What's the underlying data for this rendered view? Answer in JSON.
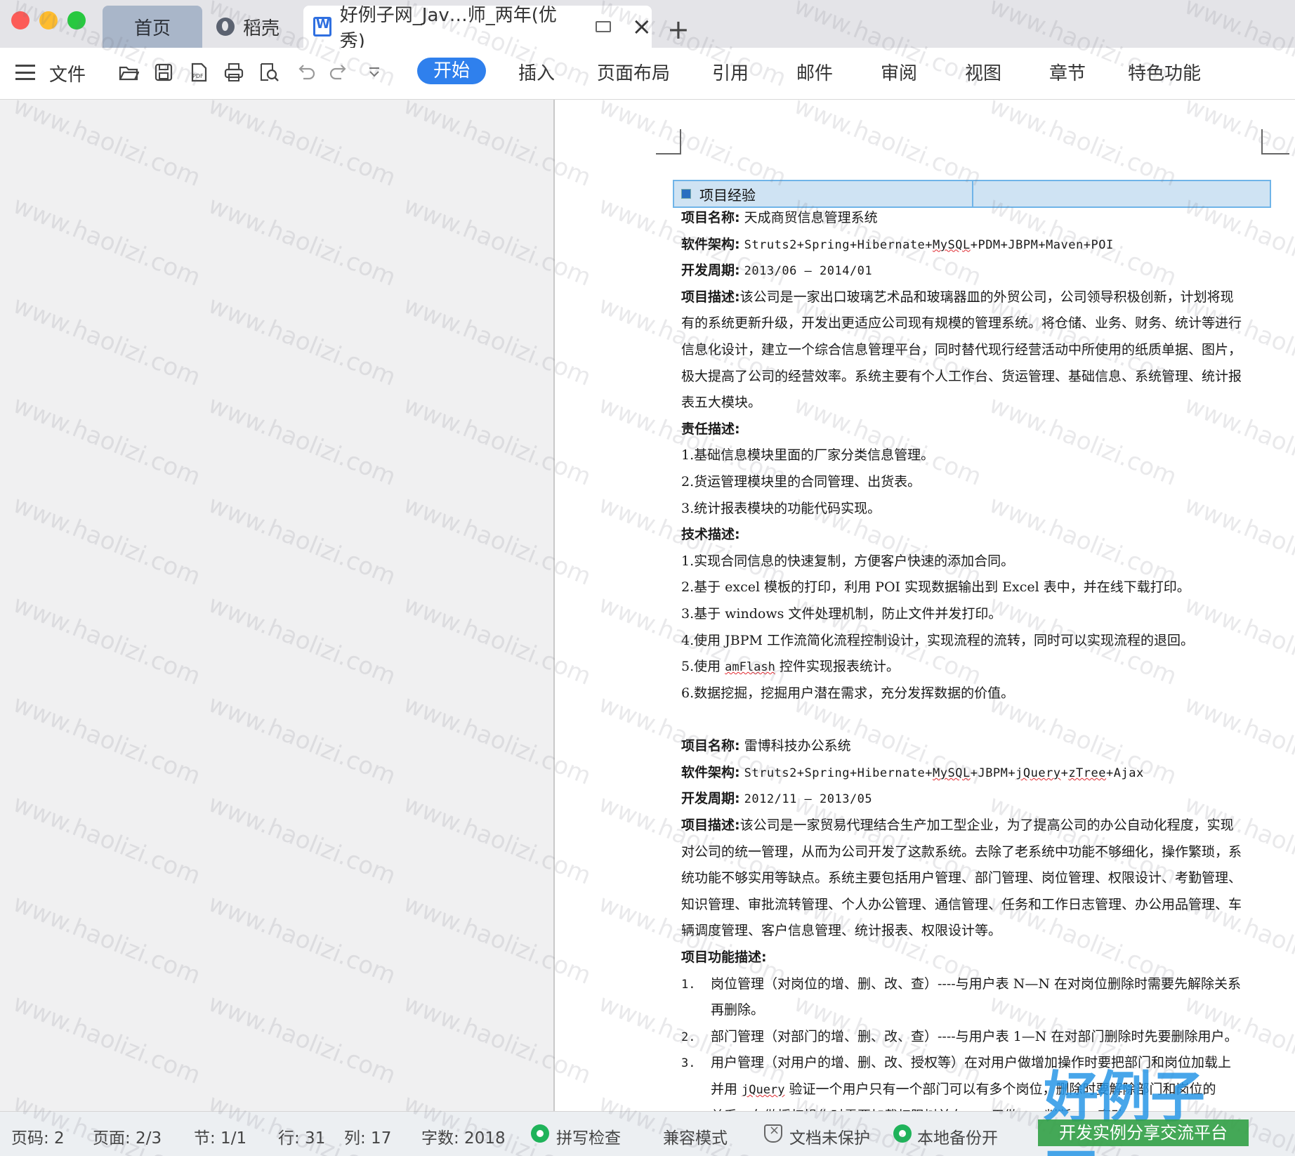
{
  "tabs": {
    "home": "首页",
    "daoke": "稻壳",
    "document": "好例子网_Jav…师_两年(优秀)",
    "add": "+"
  },
  "toolbar": {
    "file": "文件",
    "icons": [
      "open-folder-icon",
      "save-icon",
      "pdf-icon",
      "print-icon",
      "print-preview-icon",
      "undo-icon",
      "redo-icon",
      "more-dropdown-icon"
    ],
    "ribbon_tabs": [
      "开始",
      "插入",
      "页面布局",
      "引用",
      "邮件",
      "审阅",
      "视图",
      "章节",
      "特色功能"
    ],
    "active_tab": "开始",
    "accent_color": "#2f80ed"
  },
  "document": {
    "section_title": "项目经验",
    "project1": {
      "name_label": "项目名称:",
      "name": "天成商贸信息管理系统",
      "arch_label": "软件架构:",
      "arch_a": "Struts2+Spring+Hibernate+",
      "arch_b": "MySQL",
      "arch_c": "+PDM+JBPM+Maven+POI",
      "period_label": "开发周期:",
      "period": "2013/06 – 2014/01",
      "desc_label": "项目描述:",
      "desc_lines": [
        "该公司是一家出口玻璃艺术品和玻璃器皿的外贸公司，公司领导积极创新，计划将现",
        "有的系统更新升级，开发出更适应公司现有规模的管理系统。将仓储、业务、财务、统计等进行",
        "信息化设计，建立一个综合信息管理平台，同时替代现行经营活动中所使用的纸质单据、图片，",
        "极大提高了公司的经营效率。系统主要有个人工作台、货运管理、基础信息、系统管理、统计报",
        "表五大模块。"
      ],
      "resp_label": "责任描述:",
      "resp": [
        "1.基础信息模块里面的厂家分类信息管理。",
        "2.货运管理模块里的合同管理、出货表。",
        "3.统计报表模块的功能代码实现。"
      ],
      "tech_label": "技术描述:",
      "tech": [
        "1.实现合同信息的快速复制，方便客户快速的添加合同。",
        "2.基于 excel 模板的打印，利用 POI 实现数据输出到 Excel 表中，并在线下载打印。",
        "3.基于 windows 文件处理机制，防止文件并发打印。",
        "4.使用 JBPM 工作流简化流程控制设计，实现流程的流转，同时可以实现流程的退回。"
      ],
      "tech5_a": "5.使用 ",
      "tech5_b": "amFlash",
      "tech5_c": " 控件实现报表统计。",
      "tech6": "6.数据挖掘，挖掘用户潜在需求，充分发挥数据的价值。"
    },
    "project2": {
      "name_label": "项目名称:",
      "name": "雷博科技办公系统",
      "arch_label": "软件架构:",
      "arch_a": "Struts2+Spring+Hibernate+",
      "arch_b": "MySQL",
      "arch_c": "+JBPM+",
      "arch_d": "jQuery",
      "arch_e": "+",
      "arch_f": "zTree",
      "arch_g": "+Ajax",
      "period_label": "开发周期:",
      "period": "2012/11 – 2013/05",
      "desc_label": "项目描述:",
      "desc_lines": [
        "该公司是一家贸易代理结合生产加工型企业，为了提高公司的办公自动化程度，实现",
        "对公司的统一管理，从而为公司开发了这款系统。去除了老系统中功能不够细化，操作繁琐，系",
        "统功能不够实用等缺点。系统主要包括用户管理、部门管理、岗位管理、权限设计、考勤管理、",
        "知识管理、审批流转管理、个人办公管理、通信管理、任务和工作日志管理、办公用品管理、车",
        "辆调度管理、客户信息管理、统计报表、权限设计等。"
      ],
      "func_label": "项目功能描述:",
      "func": [
        {
          "num": "1.",
          "text": "岗位管理（对岗位的增、删、改、查）----与用户表 N—N 在对岗位删除时需要先解除关系"
        },
        {
          "num": "",
          "text": "再删除。"
        },
        {
          "num": "2.",
          "text": "部门管理（对部门的增、删、改、查）----与用户表 1—N 在对部门删除时先要删除用户。"
        },
        {
          "num": "3.",
          "text": "用户管理（对用户的增、删、改、授权等）在对用户做增加操作时要把部门和岗位加载上"
        }
      ],
      "func3_a": "并用 ",
      "func3_b": "jQuery",
      "func3_c": " 验证一个用户只有一个部门可以有多个岗位，删除时要解除部门和岗位的",
      "func3_d": "关系，在做授权操作时需要加载权限树并在……用做……判断……变动……"
    }
  },
  "status": {
    "page_code": "页码: 2",
    "page": "页面: 2/3",
    "section": "节: 1/1",
    "row": "行: 31",
    "col": "列: 17",
    "words": "字数: 2018",
    "spell": "拼写检查",
    "compat": "兼容模式",
    "protect": "文档未保护",
    "backup": "本地备份开"
  },
  "watermark": {
    "text": "www.haolizi.com",
    "logo": "好例子网",
    "logo_sub": "开发实例分享交流平台"
  }
}
